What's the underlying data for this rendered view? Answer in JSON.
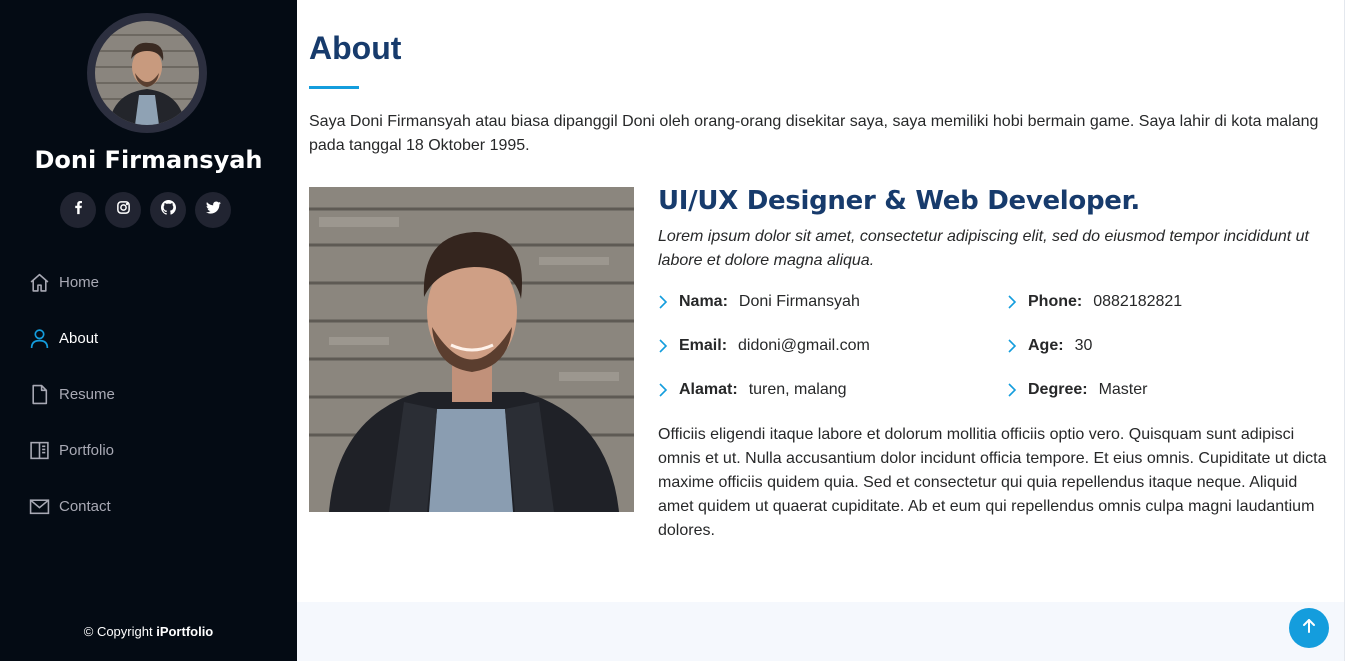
{
  "sidebar": {
    "profile_name": "Doni Firmansyah",
    "socials": [
      {
        "icon": "facebook-icon"
      },
      {
        "icon": "instagram-icon"
      },
      {
        "icon": "github-icon"
      },
      {
        "icon": "twitter-icon"
      }
    ],
    "nav": [
      {
        "label": "Home",
        "icon": "home-icon",
        "active": false
      },
      {
        "label": "About",
        "icon": "person-icon",
        "active": true
      },
      {
        "label": "Resume",
        "icon": "file-icon",
        "active": false
      },
      {
        "label": "Portfolio",
        "icon": "book-icon",
        "active": false
      },
      {
        "label": "Contact",
        "icon": "envelope-icon",
        "active": false
      }
    ],
    "copyright_prefix": "© Copyright",
    "copyright_brand": "iPortfolio"
  },
  "about": {
    "title": "About",
    "intro": "Saya Doni Firmansyah atau biasa dipanggil Doni oleh orang-orang disekitar saya, saya memiliki hobi bermain game. Saya lahir di kota malang pada tanggal 18 Oktober 1995.",
    "role": "UI/UX Designer & Web Developer.",
    "lead": "Lorem ipsum dolor sit amet, consectetur adipiscing elit, sed do eiusmod tempor incididunt ut labore et dolore magna aliqua.",
    "facts": [
      {
        "label": "Nama:",
        "value": "Doni Firmansyah"
      },
      {
        "label": "Phone:",
        "value": "0882182821"
      },
      {
        "label": "Email:",
        "value": "didoni@gmail.com"
      },
      {
        "label": "Age:",
        "value": "30"
      },
      {
        "label": "Alamat:",
        "value": "turen, malang"
      },
      {
        "label": "Degree:",
        "value": "Master"
      }
    ],
    "body": "Officiis eligendi itaque labore et dolorum mollitia officiis optio vero. Quisquam sunt adipisci omnis et ut. Nulla accusantium dolor incidunt officia tempore. Et eius omnis. Cupiditate ut dicta maxime officiis quidem quia. Sed et consectetur qui quia repellendus itaque neque. Aliquid amet quidem ut quaerat cupiditate. Ab et eum qui repellendus omnis culpa magni laudantium dolores."
  },
  "colors": {
    "sidebar_bg": "#040b14",
    "accent": "#149ddd",
    "heading": "#173b6c"
  },
  "back_to_top": {
    "icon": "arrow-up-icon"
  }
}
